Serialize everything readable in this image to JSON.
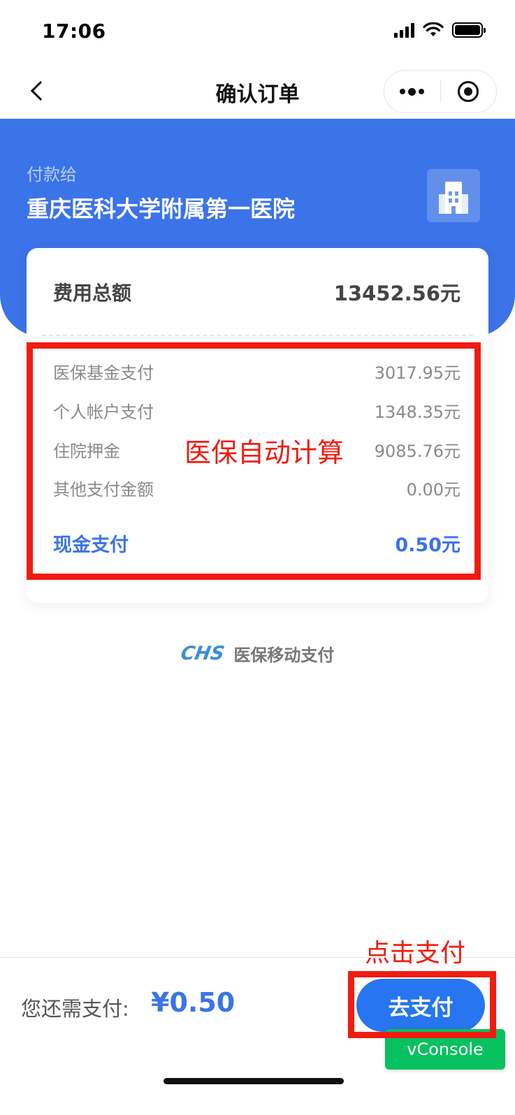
{
  "status_bar": {
    "time": "17:06"
  },
  "nav": {
    "title": "确认订单"
  },
  "payee": {
    "label": "付款给",
    "name": "重庆医科大学附属第一医院"
  },
  "fees": {
    "total_label": "费用总额",
    "total_value": "13452.56元",
    "items": [
      {
        "label": "医保基金支付",
        "value": "3017.95元"
      },
      {
        "label": "个人帐户支付",
        "value": "1348.35元"
      },
      {
        "label": "住院押金",
        "value": "9085.76元"
      },
      {
        "label": "其他支付金额",
        "value": "0.00元"
      }
    ],
    "cash_label": "现金支付",
    "cash_value": "0.50元"
  },
  "annotations": {
    "auto_calc": "医保自动计算",
    "click_pay": "点击支付"
  },
  "chs": {
    "logo": "CHS",
    "text": "医保移动支付"
  },
  "bottom": {
    "due_label": "您还需支付:",
    "due_amount": "¥0.50",
    "pay_button": "去支付"
  },
  "vconsole": {
    "label": "vConsole"
  },
  "colors": {
    "brand_blue": "#3b73e8",
    "button_blue": "#2775f0",
    "annotation_red": "#f01c0f",
    "vconsole_green": "#07c160"
  }
}
